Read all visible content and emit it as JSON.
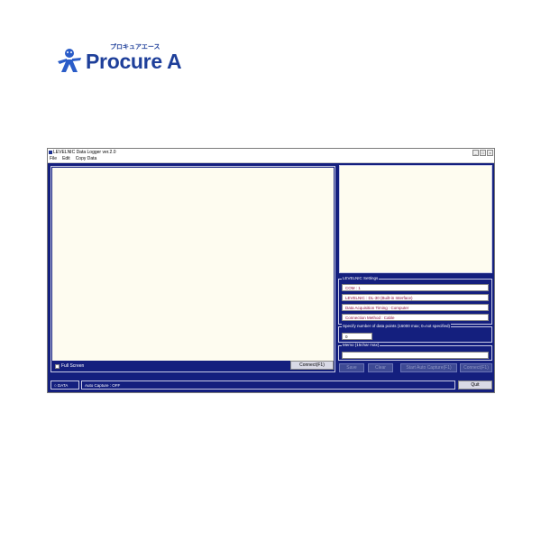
{
  "logo": {
    "text": "Procure A",
    "kana": "プロキュアエース"
  },
  "window": {
    "title": "LEVELNIC Data Logger ver.2.0",
    "controls": [
      "_",
      "□",
      "×"
    ],
    "menu": [
      "File",
      "Edit",
      "Copy Data"
    ]
  },
  "left_panel": {
    "fullscreen_label": "Full Screen",
    "connect_label": "Connect(F1)"
  },
  "settings": {
    "title": "LEVELNIC Settings",
    "fields": [
      "COM : 1",
      "LEVELNIC : DL-30 (Built-in Interface)",
      "Data Acquisition Timing : Computer",
      "Connection Method : Cable"
    ]
  },
  "points": {
    "title": "Specify number of data points (16000 max; 0=not specified)",
    "value": "0"
  },
  "memo": {
    "title": "Memo (15char max)",
    "value": ""
  },
  "buttons": {
    "save": "Save",
    "clear": "Clear",
    "start_auto": "Start Auto Capture(F1)",
    "connect": "Connect(F1)"
  },
  "status": {
    "data_label": "DATA",
    "auto_capture": "Auto Capture : OFF",
    "quit": "Quit"
  },
  "colors": {
    "panel_bg": "#141f7e",
    "graph_bg": "#fefcf0",
    "brand": "#1e3f9a"
  }
}
